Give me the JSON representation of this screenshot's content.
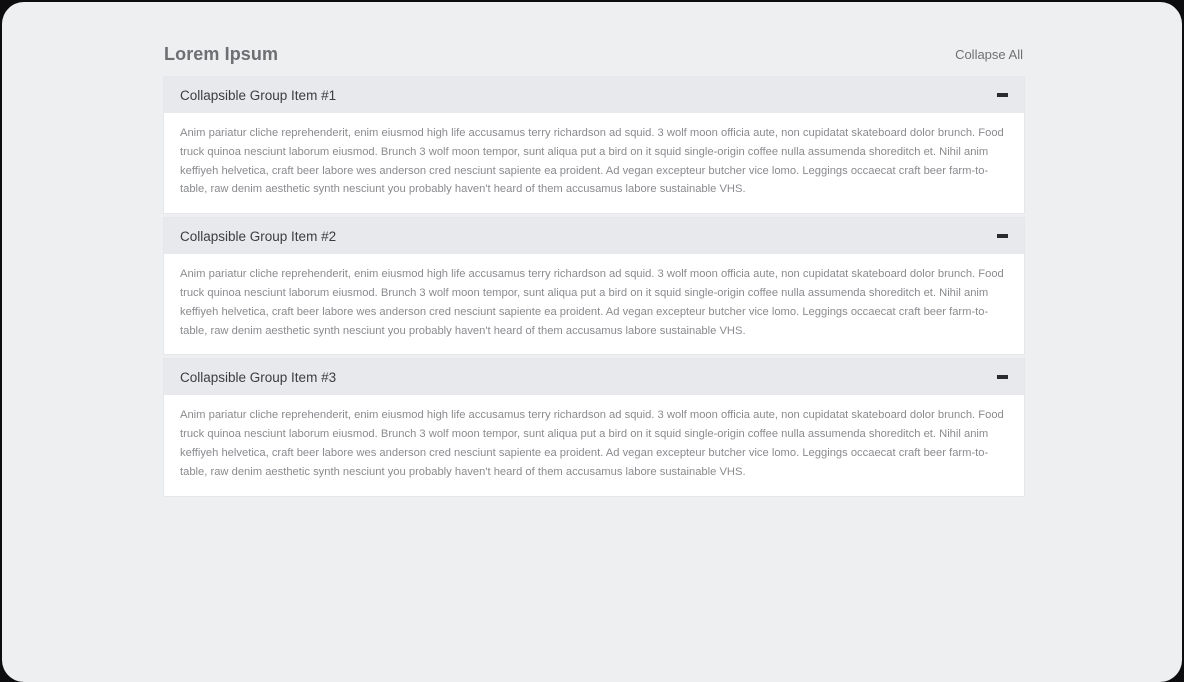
{
  "page": {
    "title": "Lorem Ipsum",
    "collapse_all_label": "Collapse All"
  },
  "panels": [
    {
      "title": "Collapsible Group Item #1",
      "toggle_icon": "minus-icon",
      "body": "Anim pariatur cliche reprehenderit, enim eiusmod high life accusamus terry richardson ad squid. 3 wolf moon officia aute, non cupidatat skateboard dolor brunch. Food truck quinoa nesciunt laborum eiusmod. Brunch 3 wolf moon tempor, sunt aliqua put a bird on it squid single-origin coffee nulla assumenda shoreditch et. Nihil anim keffiyeh helvetica, craft beer labore wes anderson cred nesciunt sapiente ea proident. Ad vegan excepteur butcher vice lomo. Leggings occaecat craft beer farm-to-table, raw denim aesthetic synth nesciunt you probably haven't heard of them accusamus labore sustainable VHS."
    },
    {
      "title": "Collapsible Group Item #2",
      "toggle_icon": "minus-icon",
      "body": "Anim pariatur cliche reprehenderit, enim eiusmod high life accusamus terry richardson ad squid. 3 wolf moon officia aute, non cupidatat skateboard dolor brunch. Food truck quinoa nesciunt laborum eiusmod. Brunch 3 wolf moon tempor, sunt aliqua put a bird on it squid single-origin coffee nulla assumenda shoreditch et. Nihil anim keffiyeh helvetica, craft beer labore wes anderson cred nesciunt sapiente ea proident. Ad vegan excepteur butcher vice lomo. Leggings occaecat craft beer farm-to-table, raw denim aesthetic synth nesciunt you probably haven't heard of them accusamus labore sustainable VHS."
    },
    {
      "title": "Collapsible Group Item #3",
      "toggle_icon": "minus-icon",
      "body": "Anim pariatur cliche reprehenderit, enim eiusmod high life accusamus terry richardson ad squid. 3 wolf moon officia aute, non cupidatat skateboard dolor brunch. Food truck quinoa nesciunt laborum eiusmod. Brunch 3 wolf moon tempor, sunt aliqua put a bird on it squid single-origin coffee nulla assumenda shoreditch et. Nihil anim keffiyeh helvetica, craft beer labore wes anderson cred nesciunt sapiente ea proident. Ad vegan excepteur butcher vice lomo. Leggings occaecat craft beer farm-to-table, raw denim aesthetic synth nesciunt you probably haven't heard of them accusamus labore sustainable VHS."
    }
  ],
  "colors": {
    "page_background": "#eeeff1",
    "panel_header": "#e8e9ec",
    "panel_body": "#ffffff",
    "title_text": "#6e6f73",
    "body_text": "#8a8b8f"
  }
}
